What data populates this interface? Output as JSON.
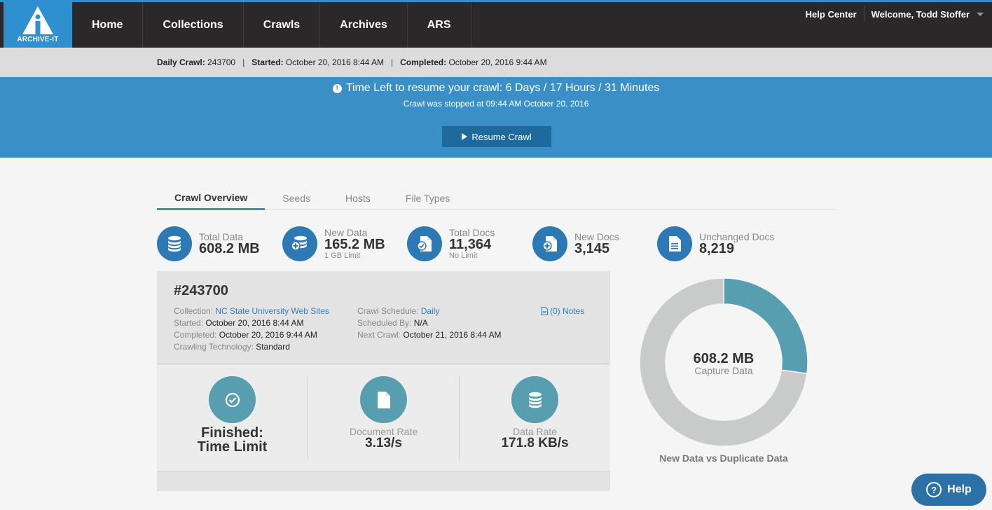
{
  "nav": {
    "logo_text": "ARCHIVE-IT",
    "items": [
      "Home",
      "Collections",
      "Crawls",
      "Archives",
      "ARS"
    ],
    "help_center": "Help Center",
    "welcome": "Welcome, Todd Stoffer"
  },
  "info": {
    "daily_label": "Daily Crawl:",
    "daily_value": "243700",
    "started_label": "Started:",
    "started_value": "October 20, 2016 8:44 AM",
    "completed_label": "Completed:",
    "completed_value": "October 20, 2016 9:44 AM"
  },
  "banner": {
    "title": "Time Left to resume your crawl: 6 Days / 17 Hours / 31 Minutes",
    "subtitle": "Crawl was stopped at 09:44 AM October 20, 2016",
    "button": "Resume Crawl",
    "color": "#3a8fc6"
  },
  "tabs": [
    "Crawl Overview",
    "Seeds",
    "Hosts",
    "File Types"
  ],
  "stats": [
    {
      "label": "Total Data",
      "value": "608.2 MB",
      "sub": "",
      "icon": "database-icon"
    },
    {
      "label": "New Data",
      "value": "165.2 MB",
      "sub": "1 GB Limit",
      "icon": "database-plus-icon"
    },
    {
      "label": "Total Docs",
      "value": "11,364",
      "sub": "No Limit",
      "icon": "document-check-icon"
    },
    {
      "label": "New Docs",
      "value": "3,145",
      "sub": "",
      "icon": "document-plus-icon"
    },
    {
      "label": "Unchanged Docs",
      "value": "8,219",
      "sub": "",
      "icon": "document-lines-icon"
    }
  ],
  "detail": {
    "id": "#243700",
    "collection_label": "Collection:",
    "collection_value": "NC State University Web Sites",
    "started_label": "Started:",
    "started_value": "October 20, 2016 8:44 AM",
    "completed_label": "Completed:",
    "completed_value": "October 20, 2016 9:44 AM",
    "tech_label": "Crawling Technology:",
    "tech_value": "Standard",
    "schedule_label": "Crawl Schedule:",
    "schedule_value": "Daily",
    "scheduled_by_label": "Scheduled By:",
    "scheduled_by_value": "N/A",
    "next_label": "Next Crawl:",
    "next_value": "October 21, 2016 8:44 AM",
    "notes": "(0) Notes"
  },
  "metrics": {
    "status_line1": "Finished:",
    "status_line2": "Time Limit",
    "doc_rate_label": "Document Rate",
    "doc_rate_value": "3.13/s",
    "data_rate_label": "Data Rate",
    "data_rate_value": "171.8 KB/s"
  },
  "chart_data": {
    "type": "pie",
    "title": "New Data vs Duplicate Data",
    "center_value": "608.2 MB",
    "center_label": "Capture Data",
    "slices": [
      {
        "name": "New Data",
        "value": 165.2,
        "color": "#579eb0"
      },
      {
        "name": "Duplicate Data",
        "value": 443.0,
        "color": "#c9cbcb"
      }
    ]
  },
  "help": {
    "label": "Help"
  }
}
